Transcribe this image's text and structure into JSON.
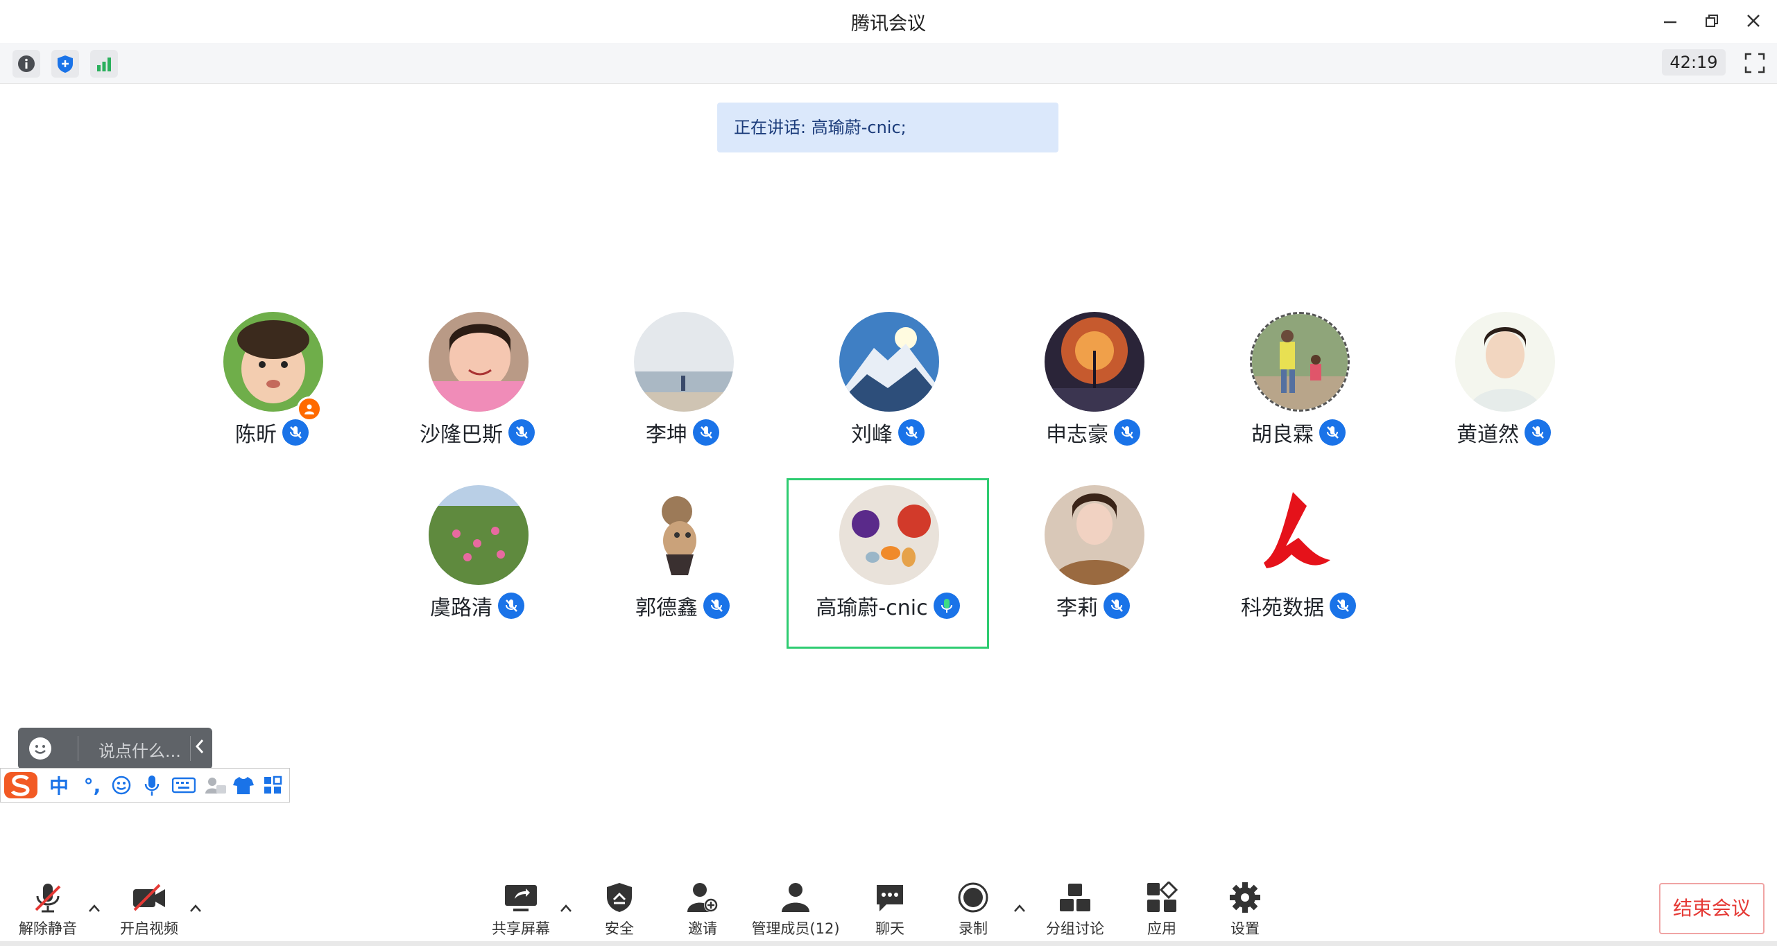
{
  "window": {
    "title": "腾讯会议"
  },
  "topbar": {
    "timer": "42:19"
  },
  "speaking": {
    "text": "正在讲话: 高瑜蔚-cnic;"
  },
  "participants": [
    {
      "name": "陈昕",
      "host": true
    },
    {
      "name": "沙隆巴斯"
    },
    {
      "name": "李坤"
    },
    {
      "name": "刘峰"
    },
    {
      "name": "申志豪"
    },
    {
      "name": "胡良霖"
    },
    {
      "name": "黄道然"
    },
    {
      "name": "虞路清"
    },
    {
      "name": "郭德鑫"
    },
    {
      "name": "高瑜蔚-cnic",
      "speaking": true
    },
    {
      "name": "李莉"
    },
    {
      "name": "科苑数据"
    }
  ],
  "chat": {
    "placeholder": "说点什么..."
  },
  "ime": {
    "mode": "中",
    "punct": "°,"
  },
  "bottombar": {
    "unmute": "解除静音",
    "video": "开启视频",
    "share": "共享屏幕",
    "security": "安全",
    "invite": "邀请",
    "members": "管理成员(12)",
    "chat": "聊天",
    "record": "录制",
    "breakout": "分组讨论",
    "apps": "应用",
    "settings": "设置",
    "end": "结束会议"
  },
  "colors": {
    "accent": "#1a73e8",
    "speaking_border": "#2ecc71",
    "end_text": "#e53935",
    "banner_bg": "#dbe8fb"
  }
}
